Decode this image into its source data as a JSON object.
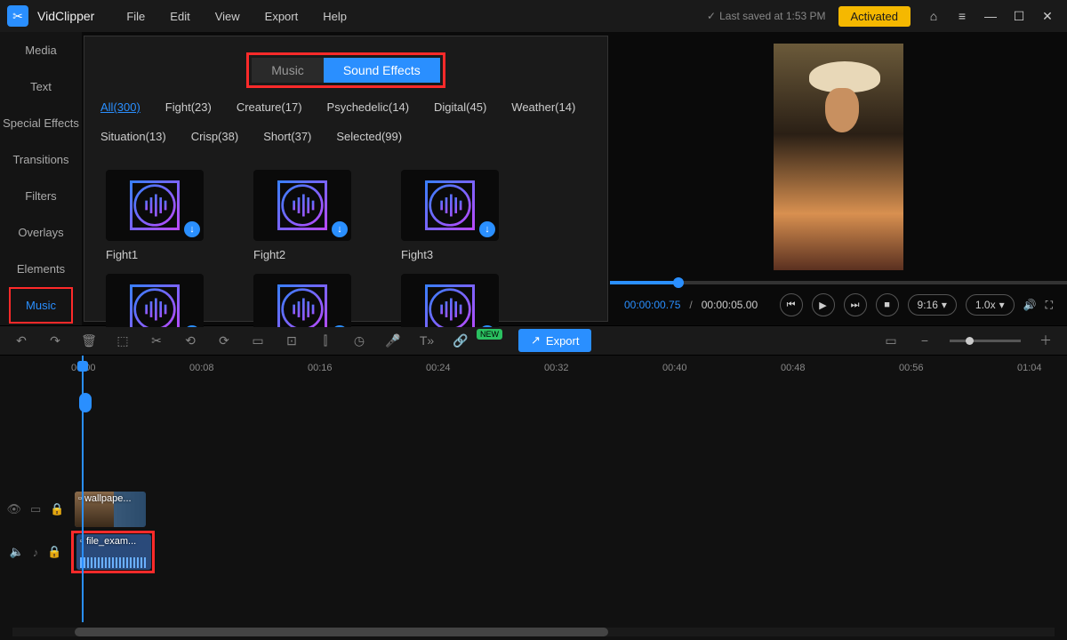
{
  "titlebar": {
    "app_name": "VidClipper",
    "menu": [
      "File",
      "Edit",
      "View",
      "Export",
      "Help"
    ],
    "saved_text": "Last saved at 1:53 PM",
    "activated": "Activated"
  },
  "sidebar": {
    "tabs": [
      "Media",
      "Text",
      "Special Effects",
      "Transitions",
      "Filters",
      "Overlays",
      "Elements",
      "Music"
    ],
    "active_index": 7
  },
  "browser": {
    "segments": {
      "left": "Music",
      "right": "Sound Effects",
      "active": "right"
    },
    "categories": [
      {
        "label": "All",
        "count": 300,
        "active": true
      },
      {
        "label": "Fight",
        "count": 23
      },
      {
        "label": "Creature",
        "count": 17
      },
      {
        "label": "Psychedelic",
        "count": 14
      },
      {
        "label": "Digital",
        "count": 45
      },
      {
        "label": "Weather",
        "count": 14
      },
      {
        "label": "Situation",
        "count": 13
      },
      {
        "label": "Crisp",
        "count": 38
      },
      {
        "label": "Short",
        "count": 37
      },
      {
        "label": "Selected",
        "count": 99
      }
    ],
    "tiles": [
      "Fight1",
      "Fight2",
      "Fight3",
      "",
      "",
      ""
    ]
  },
  "player": {
    "current": "00:00:00.75",
    "total": "00:00:05.00",
    "aspect": "9:16",
    "speed": "1.0x"
  },
  "toolbar": {
    "export": "Export",
    "new": "NEW"
  },
  "timeline": {
    "marks": [
      "00:00",
      "00:08",
      "00:16",
      "00:24",
      "00:32",
      "00:40",
      "00:48",
      "00:56",
      "01:04"
    ],
    "video_clip": "wallpape...",
    "audio_clip": "file_exam..."
  }
}
